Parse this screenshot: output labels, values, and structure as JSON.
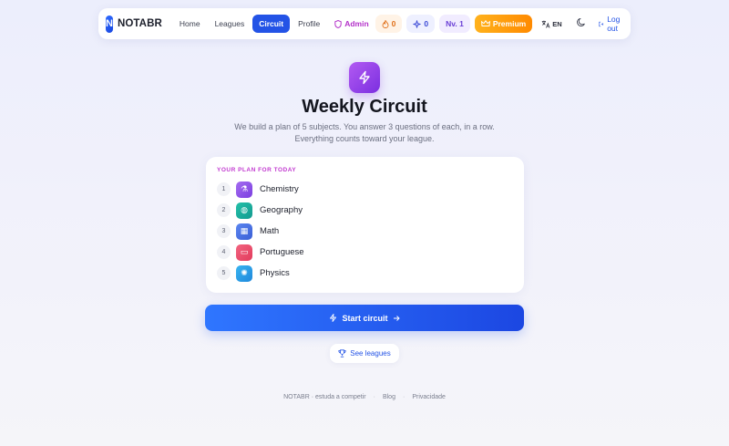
{
  "nav": {
    "logo_letter": "N",
    "logo_text": "NOTABR",
    "links": [
      {
        "label": "Home"
      },
      {
        "label": "Leagues"
      },
      {
        "label": "Circuit"
      },
      {
        "label": "Profile"
      },
      {
        "label": "Admin"
      }
    ],
    "streak": "0",
    "xp": "0",
    "level": "Nv. 1",
    "premium": "Premium",
    "lang": "EN",
    "logout": "Log out"
  },
  "hero": {
    "title": "Weekly Circuit",
    "subtitle_1": "We build a plan of 5 subjects. You answer 3 questions of each, in a row.",
    "subtitle_2": "Everything counts toward your league."
  },
  "plan": {
    "label": "YOUR PLAN FOR TODAY",
    "items": [
      {
        "num": "1",
        "name": "Chemistry",
        "icon": "flask-icon",
        "color": "#8e4fe0"
      },
      {
        "num": "2",
        "name": "Geography",
        "icon": "globe-icon",
        "color": "#19a9a0"
      },
      {
        "num": "3",
        "name": "Math",
        "icon": "calculator-icon",
        "color": "#4a74e6"
      },
      {
        "num": "4",
        "name": "Portuguese",
        "icon": "book-icon",
        "color": "#ec4a6a"
      },
      {
        "num": "5",
        "name": "Physics",
        "icon": "atom-icon",
        "color": "#2a9ee6"
      }
    ]
  },
  "cta": {
    "start": "Start circuit",
    "see_leagues": "See leagues"
  },
  "footer": {
    "brand": "NOTABR · estuda a competir",
    "blog": "Blog",
    "privacy": "Privacidade"
  }
}
